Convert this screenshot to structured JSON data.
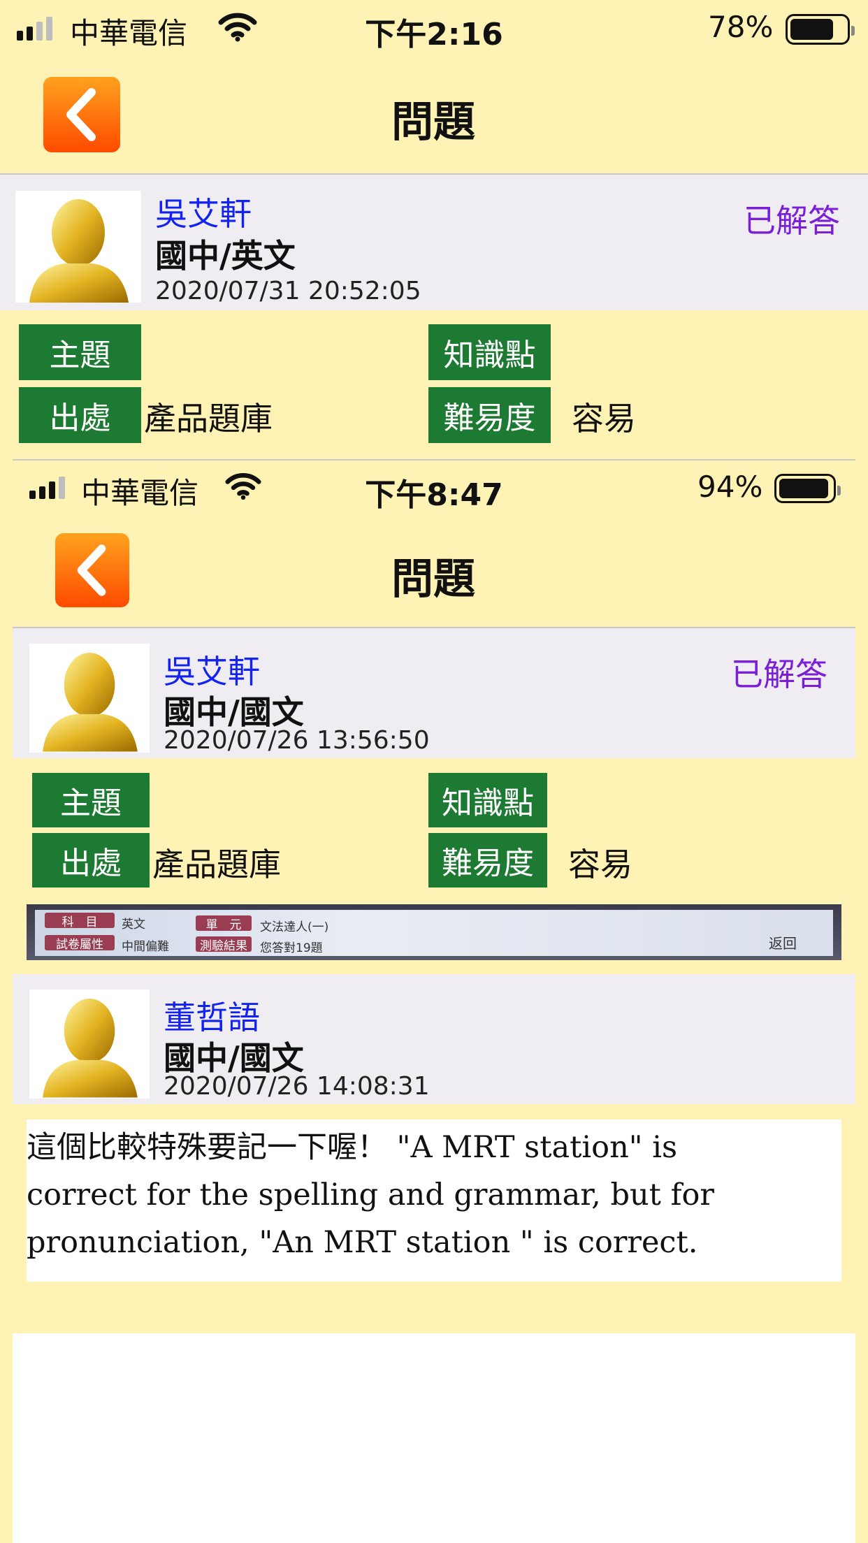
{
  "outer": {
    "status": {
      "carrier": "中華電信",
      "time": "下午2:16",
      "battery": "78%",
      "battery_level": 0.78
    },
    "nav": {
      "title": "問題",
      "back_icon": "chevron-left-icon"
    },
    "question": {
      "name": "吳艾軒",
      "subject": "國中/英文",
      "time": "2020/07/31 20:52:05",
      "status": "已解答",
      "tags": {
        "topic_label": "主題",
        "topic_value": "",
        "knowledge_label": "知識點",
        "knowledge_value": "",
        "source_label": "出處",
        "source_value": "產品題庫",
        "difficulty_label": "難易度",
        "difficulty_value": "容易"
      }
    }
  },
  "inner": {
    "status": {
      "carrier": "中華電信",
      "time": "下午8:47",
      "battery": "94%",
      "battery_level": 0.94
    },
    "nav": {
      "title": "問題"
    },
    "question": {
      "name": "吳艾軒",
      "subject": "國中/國文",
      "time": "2020/07/26 13:56:50",
      "status": "已解答",
      "tags": {
        "topic_label": "主題",
        "topic_value": "",
        "knowledge_label": "知識點",
        "knowledge_value": "",
        "source_label": "出處",
        "source_value": "產品題庫",
        "difficulty_label": "難易度",
        "difficulty_value": "容易"
      }
    },
    "question_image": {
      "subject_label": "科　目",
      "subject_value": "英文",
      "unit_label": "單　元",
      "unit_value": "文法達人(一)",
      "attr_label": "試卷屬性",
      "attr_value": "中間偏難",
      "result_label": "測驗結果",
      "result_value": "您答對19題",
      "back_label": "返回"
    },
    "answer": {
      "name": "董哲語",
      "subject": "國中/國文",
      "time": "2020/07/26 14:08:31",
      "text_lines": [
        "這個比較特殊要記一下喔！ \"A MRT station\" is",
        "correct for the spelling and grammar, but for",
        "pronunciation, \"An MRT station \" is correct."
      ]
    }
  },
  "colors": {
    "background": "#FEF3B4",
    "tag": "#1D7A32",
    "name": "#1222F0",
    "status": "#7A1FD6",
    "back_button": "#FF6A0A"
  }
}
